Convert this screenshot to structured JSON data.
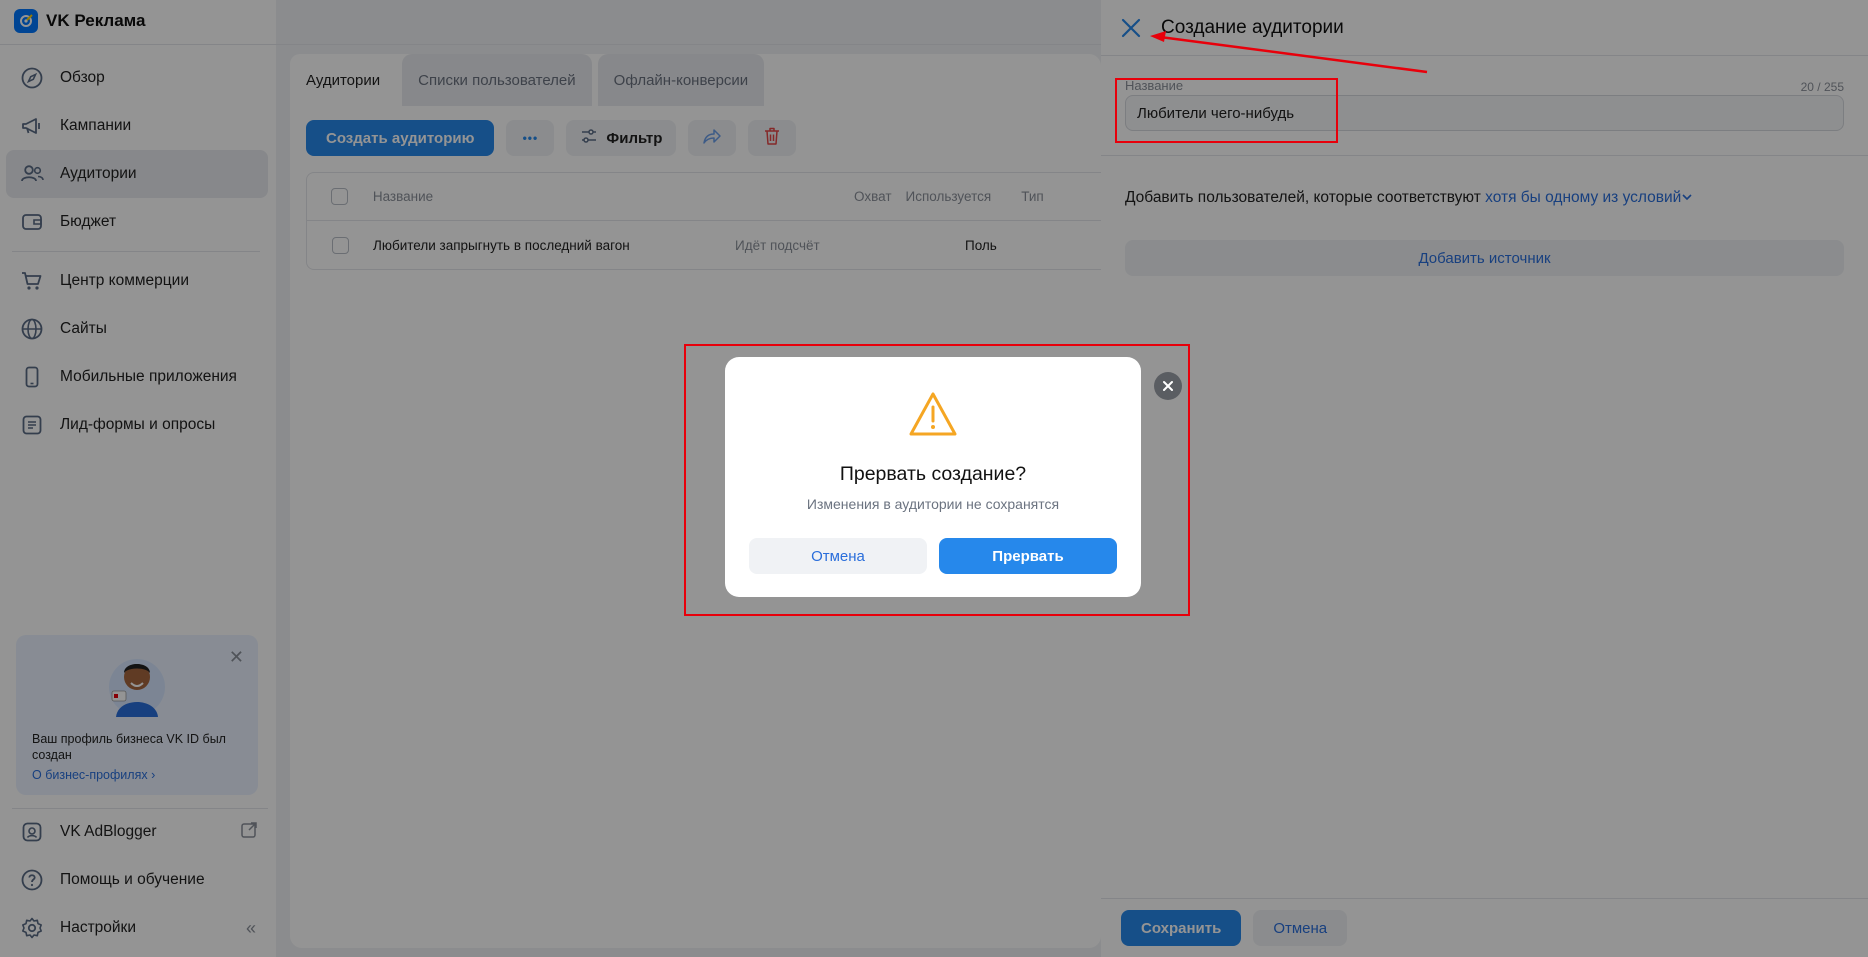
{
  "brand": {
    "name": "VK Реклама"
  },
  "nav": {
    "items": [
      {
        "label": "Обзор",
        "icon": "compass-icon"
      },
      {
        "label": "Кампании",
        "icon": "megaphone-icon"
      },
      {
        "label": "Аудитории",
        "icon": "users-icon",
        "active": true
      },
      {
        "label": "Бюджет",
        "icon": "wallet-icon"
      },
      {
        "label": "Центр коммерции",
        "icon": "cart-icon"
      },
      {
        "label": "Сайты",
        "icon": "globe-icon"
      },
      {
        "label": "Мобильные приложения",
        "icon": "phone-icon"
      },
      {
        "label": "Лид-формы и опросы",
        "icon": "form-icon"
      }
    ],
    "bottom": [
      {
        "label": "VK AdBlogger",
        "icon": "adblogger-icon"
      },
      {
        "label": "Помощь и обучение",
        "icon": "help-icon"
      },
      {
        "label": "Настройки",
        "icon": "gear-icon"
      }
    ]
  },
  "promo": {
    "text": "Ваш профиль бизнеса VK ID был создан",
    "link": "О бизнес-профилях"
  },
  "tabs": [
    "Аудитории",
    "Списки пользователей",
    "Офлайн-конверсии"
  ],
  "toolbar": {
    "create": "Создать аудиторию",
    "more": "•••",
    "filter": "Фильтр"
  },
  "table": {
    "headers": {
      "name": "Название",
      "reach": "Охват",
      "used": "Используется",
      "type": "Тип"
    },
    "rows": [
      {
        "name": "Любители запрыгнуть в последний вагон",
        "reach": "Идёт подсчёт",
        "used": "",
        "type": "Поль"
      }
    ]
  },
  "panel": {
    "title": "Создание аудитории",
    "field_label": "Название",
    "field_counter": "20 / 255",
    "field_value": "Любители чего-нибудь",
    "cond_prefix": "Добавить пользователей, которые соответствуют ",
    "cond_link": "хотя бы одному из условий",
    "add_source": "Добавить источник",
    "save": "Сохранить",
    "cancel": "Отмена"
  },
  "modal": {
    "title": "Прервать создание?",
    "subtitle": "Изменения в аудитории не сохранятся",
    "cancel": "Отмена",
    "confirm": "Прервать"
  },
  "colors": {
    "accent": "#2688eb",
    "link": "#2a6edb",
    "warning": "#f5a623",
    "annotation": "#e8000b"
  }
}
